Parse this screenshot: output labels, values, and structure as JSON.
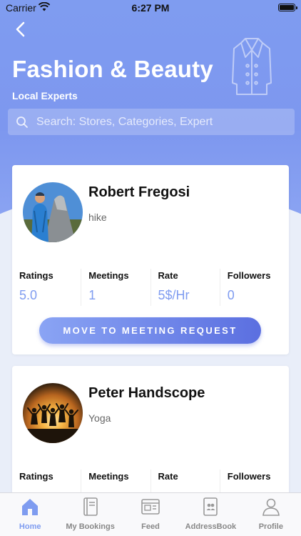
{
  "status_bar": {
    "carrier": "Carrier",
    "time": "6:27 PM"
  },
  "header": {
    "title": "Fashion & Beauty",
    "subtitle": "Local Experts",
    "search_placeholder": "Search: Stores, Categories, Expert",
    "decor_icon": "coat-icon"
  },
  "experts": [
    {
      "name": "Robert Fregosi",
      "tagline": "hike",
      "stats": [
        {
          "label": "Ratings",
          "value": "5.0"
        },
        {
          "label": "Meetings",
          "value": "1"
        },
        {
          "label": "Rate",
          "value": "5$/Hr"
        },
        {
          "label": "Followers",
          "value": "0"
        }
      ],
      "cta": "MOVE TO MEETING REQUEST"
    },
    {
      "name": "Peter Handscope",
      "tagline": "Yoga",
      "stats": [
        {
          "label": "Ratings",
          "value": ""
        },
        {
          "label": "Meetings",
          "value": ""
        },
        {
          "label": "Rate",
          "value": ""
        },
        {
          "label": "Followers",
          "value": ""
        }
      ]
    }
  ],
  "tabs": [
    {
      "label": "Home",
      "icon": "home-icon",
      "active": true
    },
    {
      "label": "My Bookings",
      "icon": "book-icon",
      "active": false
    },
    {
      "label": "Feed",
      "icon": "feed-icon",
      "active": false
    },
    {
      "label": "AddressBook",
      "icon": "address-book-icon",
      "active": false
    },
    {
      "label": "Profile",
      "icon": "profile-icon",
      "active": false
    }
  ],
  "colors": {
    "accent": "#7f9cf0",
    "button_end": "#5b6fe0",
    "background": "#e9eef9"
  }
}
